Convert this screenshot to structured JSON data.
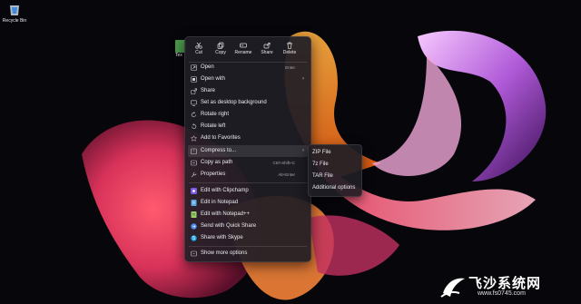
{
  "desktop": {
    "recycle_bin_label": "Recycle Bin",
    "file_label": "Tex"
  },
  "context_menu": {
    "toolbar": [
      {
        "label": "Cut",
        "icon": "scissors-icon"
      },
      {
        "label": "Copy",
        "icon": "copy-icon"
      },
      {
        "label": "Rename",
        "icon": "rename-icon"
      },
      {
        "label": "Share",
        "icon": "share-icon"
      },
      {
        "label": "Delete",
        "icon": "trash-icon"
      }
    ],
    "items": [
      {
        "label": "Open",
        "shortcut": "Enter",
        "icon": "open-icon"
      },
      {
        "label": "Open with",
        "has_submenu": true,
        "icon": "open-with-icon"
      },
      {
        "label": "Share",
        "icon": "share-icon"
      },
      {
        "label": "Set as desktop background",
        "icon": "desktop-icon"
      },
      {
        "label": "Rotate right",
        "icon": "rotate-right-icon"
      },
      {
        "label": "Rotate left",
        "icon": "rotate-left-icon"
      },
      {
        "label": "Add to Favorites",
        "icon": "star-icon"
      },
      {
        "label": "Compress to...",
        "has_submenu": true,
        "highlighted": true,
        "icon": "archive-icon"
      },
      {
        "label": "Copy as path",
        "shortcut": "Ctrl+Shift+C",
        "icon": "path-icon"
      },
      {
        "label": "Properties",
        "shortcut": "Alt+Enter",
        "icon": "wrench-icon"
      },
      {
        "label": "Edit with Clipchamp",
        "icon": "clipchamp-icon"
      },
      {
        "label": "Edit in Notepad",
        "icon": "notepad-icon"
      },
      {
        "label": "Edit with Notepad++",
        "icon": "notepadpp-icon"
      },
      {
        "label": "Send with Quick Share",
        "icon": "quick-share-icon"
      },
      {
        "label": "Share with Skype",
        "icon": "skype-icon"
      },
      {
        "label": "Show more options",
        "icon": "more-options-icon"
      }
    ]
  },
  "submenu": {
    "items": [
      "ZIP File",
      "7z File",
      "TAR File",
      "Additional options"
    ]
  },
  "watermark": {
    "title": "飞沙系统网",
    "url": "www.fs0745.com"
  },
  "colors": {
    "menu_bg": "#201e26",
    "highlight": "#3a3840",
    "text": "#ececf2"
  }
}
